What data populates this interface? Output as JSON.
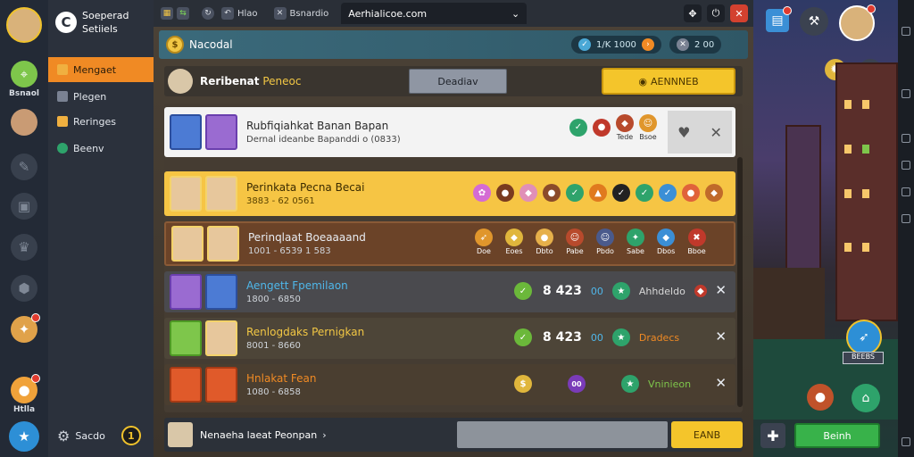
{
  "rail": {
    "items": [
      {
        "label": "Bsnaol",
        "icon": "map-icon"
      },
      {
        "label": "",
        "icon": "avatar"
      },
      {
        "label": "",
        "icon": "hammer-icon"
      },
      {
        "label": "",
        "icon": "bag-icon"
      },
      {
        "label": "",
        "icon": "crown-icon"
      },
      {
        "label": "",
        "icon": "shield-icon"
      },
      {
        "label": "",
        "icon": "medal-icon"
      },
      {
        "label": "Htlla",
        "icon": "coin-icon"
      },
      {
        "label": "",
        "icon": "star-badge-icon"
      }
    ]
  },
  "sidebar": {
    "brand_line1": "Soeperad",
    "brand_line2": "Setiiels",
    "items": [
      {
        "label": "Mengaet",
        "active": true
      },
      {
        "label": "Plegen",
        "active": false
      },
      {
        "label": "Reringes",
        "active": false
      },
      {
        "label": "Beenv",
        "active": false
      }
    ],
    "settings_label": "Sacdo",
    "settings_count": "1"
  },
  "topbar": {
    "tabs": [
      "Hlao",
      "Bsnardio"
    ],
    "address": "Aerhialicoe.com"
  },
  "header": {
    "title": "Nacodal",
    "pill1": "1/K 1000",
    "pill2": "2 00"
  },
  "filter": {
    "label": "Reribenat",
    "label_highlight": "Peneoc",
    "gray_button": "Deadiav",
    "yellow_button": "AENNNEB"
  },
  "rows": [
    {
      "title": "Rubfiqiahkat Banan Bapan",
      "subtitle": "Dernal ideanbe Bapanddi o (0833)",
      "item_labels": [
        "",
        "",
        "Tede",
        "Bsoe"
      ]
    },
    {
      "title": "Perinkata Pecna Becai",
      "subtitle": "3883 - 62 0561"
    },
    {
      "title": "Perinqlaat Boeaaaand",
      "subtitle": "1001 - 6539 1 583",
      "item_labels": [
        "Doe",
        "Eoes",
        "Dbto",
        "Pabe",
        "Pbdo",
        "Sabe",
        "Dbos",
        "Bboe"
      ]
    },
    {
      "title": "Aengett Fpemilaon",
      "subtitle": "1800 - 6850",
      "count": "8 423",
      "count_badge": "00",
      "status": "Ahhdeldo"
    },
    {
      "title": "Renlogdaks Pernigkan",
      "subtitle": "8001 - 8660",
      "count": "8 423",
      "count_badge": "00",
      "status": "Dradecs"
    },
    {
      "title": "Hnlakat Fean",
      "subtitle": "1080 - 6858",
      "count": "",
      "count_badge": "00",
      "status": "Vninieon"
    }
  ],
  "footer": {
    "label": "Nenaeha laeat Peonpan",
    "button": "EANB"
  },
  "scene": {
    "button": "Beinh",
    "badge_label": "BEEBS"
  }
}
